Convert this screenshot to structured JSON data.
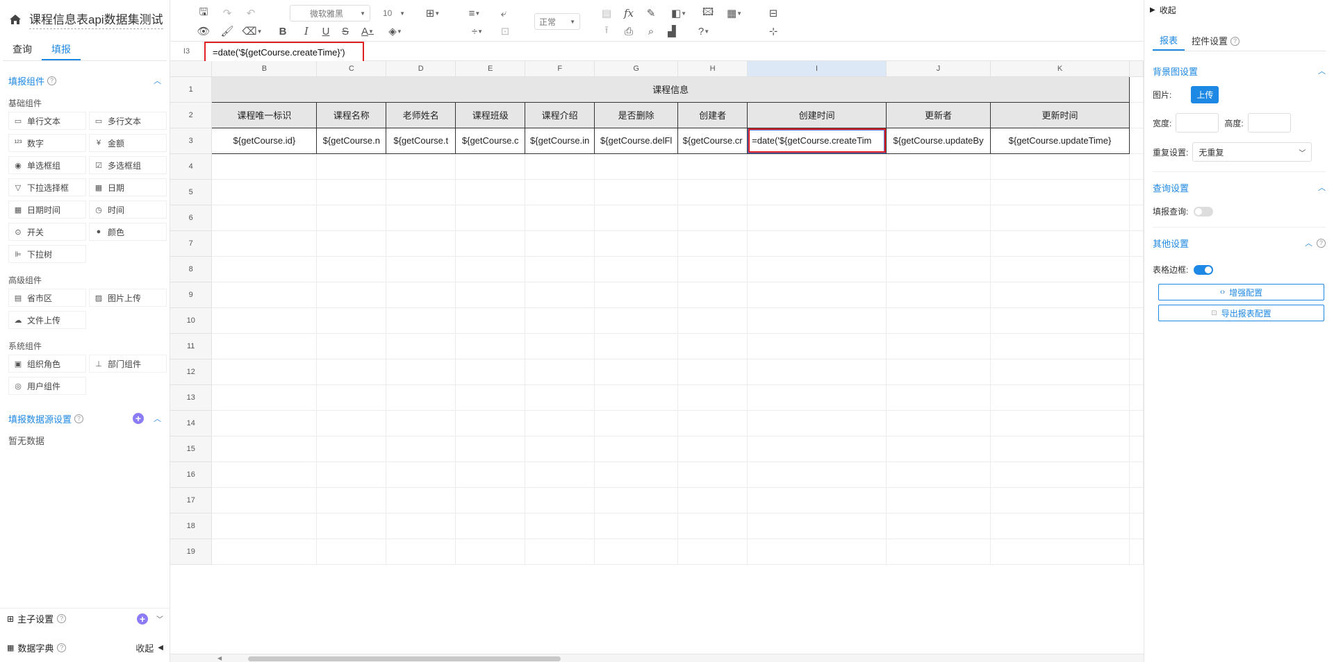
{
  "left": {
    "title": "课程信息表api数据集测试",
    "tabs": [
      "查询",
      "填报"
    ],
    "fill_section_title": "填报组件",
    "basic_label": "基础组件",
    "basic_components": [
      "单行文本",
      "多行文本",
      "数字",
      "金额",
      "单选框组",
      "多选框组",
      "下拉选择框",
      "日期",
      "日期时间",
      "时间",
      "开关",
      "颜色",
      "下拉树"
    ],
    "basic_icons": [
      "input-icon",
      "textarea-icon",
      "number-icon",
      "money-icon",
      "radio-icon",
      "checkbox-icon",
      "select-icon",
      "calendar-icon",
      "datetime-icon",
      "clock-icon",
      "switch-icon",
      "palette-icon",
      "tree-icon"
    ],
    "advanced_label": "高级组件",
    "advanced_components": [
      "省市区",
      "图片上传",
      "文件上传"
    ],
    "advanced_icons": [
      "region-icon",
      "image-upload-icon",
      "cloud-upload-icon"
    ],
    "system_label": "系统组件",
    "system_components": [
      "组织角色",
      "部门组件",
      "用户组件"
    ],
    "system_icons": [
      "org-role-icon",
      "department-icon",
      "user-icon"
    ],
    "datasource_title": "填报数据源设置",
    "no_data": "暂无数据",
    "main_sub_label": "主子设置",
    "dict_label": "数据字典",
    "collapse_label": "收起"
  },
  "toolbar": {
    "font_name": "微软雅黑",
    "font_size": "10",
    "mode": "正常"
  },
  "formula_bar": {
    "cell_ref": "I3",
    "formula": "=date('${getCourse.createTime}')"
  },
  "sheet": {
    "columns": [
      "B",
      "C",
      "D",
      "E",
      "F",
      "G",
      "H",
      "I",
      "J",
      "K"
    ],
    "selected_column": "I",
    "rows": [
      "1",
      "2",
      "3",
      "4",
      "5",
      "6",
      "7",
      "8",
      "9",
      "10",
      "11",
      "12",
      "13",
      "14",
      "15",
      "16",
      "17",
      "18",
      "19"
    ],
    "title": "课程信息",
    "headers": [
      "课程唯一标识",
      "课程名称",
      "老师姓名",
      "课程班级",
      "课程介绍",
      "是否删除",
      "创建者",
      "创建时间",
      "更新者",
      "更新时间"
    ],
    "data_row": [
      "${getCourse.id}",
      "${getCourse.n",
      "${getCourse.t",
      "${getCourse.c",
      "${getCourse.in",
      "${getCourse.delFl",
      "${getCourse.cr",
      "=date('${getCourse.createTim",
      "${getCourse.updateBy",
      "${getCourse.updateTime}"
    ]
  },
  "right": {
    "collapse_label": "收起",
    "tabs": [
      "报表",
      "控件设置"
    ],
    "bg_section": "背景图设置",
    "image_label": "图片:",
    "upload_label": "上传",
    "width_label": "宽度:",
    "height_label": "高度:",
    "repeat_label": "重复设置:",
    "repeat_value": "无重复",
    "query_section": "查询设置",
    "fill_query_label": "填报查询:",
    "other_section": "其他设置",
    "border_label": "表格边框:",
    "enhance_label": "增强配置",
    "export_label": "导出报表配置"
  },
  "colors": {
    "accent": "#1e88e5",
    "highlight": "#e02020"
  }
}
